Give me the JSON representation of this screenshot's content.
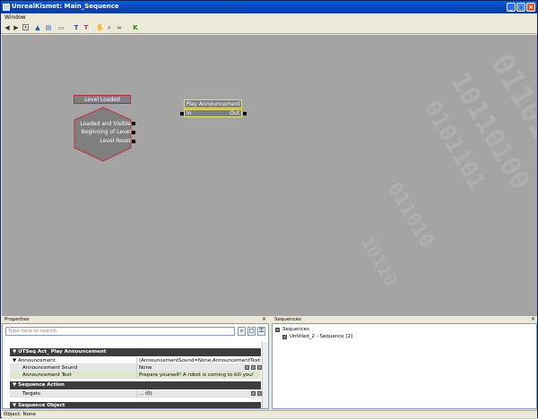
{
  "window": {
    "title": "UnrealKismet: Main_Sequence",
    "min_glyph": "_",
    "max_glyph": "□",
    "close_glyph": "×"
  },
  "menu": {
    "window_label": "Window"
  },
  "toolbar": {
    "icons": [
      "back-arrow",
      "forward-arrow",
      "dropdown",
      "parent-sequence",
      "rename",
      "search",
      "tools-1",
      "tools-2",
      "hand",
      "zoom",
      "link",
      "kismet-k"
    ],
    "k_label": "K"
  },
  "canvas": {
    "background": "#a4a4a4",
    "level_loaded": {
      "title": "Level Loaded",
      "outputs": [
        "Loaded and Visible",
        "Beginning of Level",
        "Level Reset"
      ],
      "border_color": "#b0303a"
    },
    "play_announcement": {
      "title": "Play Announcement",
      "input": "In",
      "output": "Out",
      "border_color": "#e8e070"
    }
  },
  "properties": {
    "title": "Properties",
    "close_glyph": "×",
    "search_placeholder": "Type here to search",
    "object_header": "UTSeq Act_ Play Announcement",
    "rows": [
      {
        "key": "Announcement",
        "value": "(AnnouncementSound=None,AnnouncementText=)"
      },
      {
        "key": "Announcement Sound",
        "value": "None"
      },
      {
        "key": "Announcement Text",
        "value": "Prepare yourself! A robot is coming to kill you!"
      }
    ],
    "section_action": "Sequence Action",
    "targets_key": "Targets",
    "targets_value": "... (0)",
    "section_object": "Sequence Object"
  },
  "sequences": {
    "title": "Sequences",
    "close_glyph": "×",
    "root": "Sequences",
    "child": "Untitled_2 - Sequence [2]"
  },
  "status": {
    "text": "Object: None"
  }
}
